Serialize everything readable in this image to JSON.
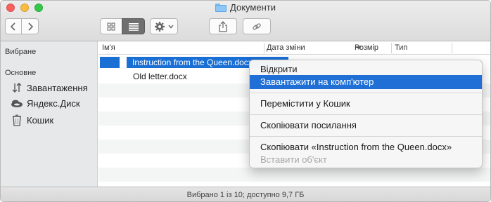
{
  "window": {
    "title": "Документи"
  },
  "toolbar": {
    "back_icon": "chevron-left",
    "forward_icon": "chevron-right",
    "icon_view_icon": "grid",
    "list_view_icon": "list",
    "action_icon": "gear",
    "share_icon": "share-upload",
    "link_icon": "link"
  },
  "sidebar": {
    "favorites_header": "Вибране",
    "main_header": "Основне",
    "items": [
      {
        "label": "Завантаження",
        "icon": "download-arrows"
      },
      {
        "label": "Яндекс.Диск",
        "icon": "cloud-disk"
      },
      {
        "label": "Кошик",
        "icon": "trash"
      }
    ]
  },
  "columns": {
    "name": "Ім'я",
    "date": "Дата зміни",
    "size": "Розмір",
    "type": "Тип"
  },
  "files": [
    {
      "name": "Instruction from the Queen.docx",
      "selected": true
    },
    {
      "name": "Old letter.docx",
      "selected": false
    }
  ],
  "context_menu": {
    "items": [
      {
        "label": "Відкрити"
      },
      {
        "label": "Завантажити на комп'ютер"
      },
      {
        "label": "Перемістити у Кошик"
      },
      {
        "label": "Скопіювати посилання"
      },
      {
        "label": "Скопіювати «Instruction from the Queen.docx»"
      },
      {
        "label": "Вставити об'єкт"
      }
    ]
  },
  "status_bar": {
    "text": "Вибрано 1 із 10; доступно 9,7 ГБ"
  },
  "colors": {
    "selection": "#1a6fd4",
    "menu_highlight": "#1f6fd6",
    "close": "#fc605c",
    "minimize": "#fdbc40",
    "maximize": "#34c84a"
  }
}
